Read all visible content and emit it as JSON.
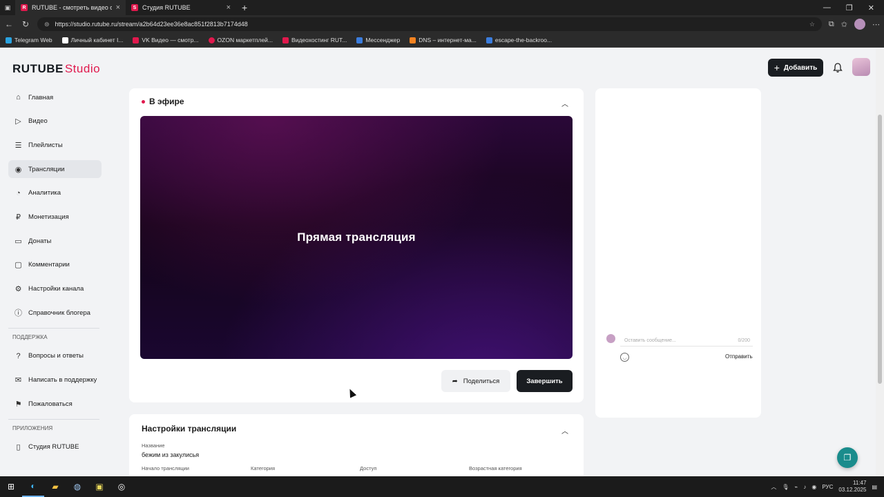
{
  "browser": {
    "tabs": [
      {
        "title": "RUTUBE - смотреть видео онла...",
        "icon": "R"
      },
      {
        "title": "Студия RUTUBE",
        "icon": "S"
      }
    ],
    "url": "https://studio.rutube.ru/stream/a2b64d23ee36e8ac851f2813b7174d48",
    "bookmarks": [
      {
        "label": "Telegram Web",
        "color": "#2aa3e0"
      },
      {
        "label": "Личный кабинет I...",
        "color": "#ffffff"
      },
      {
        "label": "VK Видео — смотр...",
        "color": "#e0194d"
      },
      {
        "label": "OZON маркетплей...",
        "color": "#e0194d"
      },
      {
        "label": "Видеохостинг RUT...",
        "color": "#e0194d"
      },
      {
        "label": "Мессенджер",
        "color": "#3b7ddd"
      },
      {
        "label": "DNS – интернет-ма...",
        "color": "#f58220"
      },
      {
        "label": "escape-the-backroo...",
        "color": "#3b7ddd"
      }
    ]
  },
  "header": {
    "logo_main": "RUTUBE",
    "logo_studio": "Studio",
    "add_button": "Добавить"
  },
  "sidebar": {
    "items": [
      {
        "label": "Главная",
        "icon": "home-icon"
      },
      {
        "label": "Видео",
        "icon": "video-icon"
      },
      {
        "label": "Плейлисты",
        "icon": "playlist-icon"
      },
      {
        "label": "Трансляции",
        "icon": "broadcast-icon"
      },
      {
        "label": "Аналитика",
        "icon": "analytics-icon"
      },
      {
        "label": "Монетизация",
        "icon": "ruble-icon"
      },
      {
        "label": "Донаты",
        "icon": "donate-icon"
      },
      {
        "label": "Комментарии",
        "icon": "comment-icon"
      },
      {
        "label": "Настройки канала",
        "icon": "gear-icon"
      },
      {
        "label": "Справочник блогера",
        "icon": "info-icon"
      }
    ],
    "support_heading": "ПОДДЕРЖКА",
    "support_items": [
      {
        "label": "Вопросы и ответы"
      },
      {
        "label": "Написать в поддержку"
      },
      {
        "label": "Пожаловаться"
      }
    ],
    "apps_heading": "ПРИЛОЖЕНИЯ",
    "apps_items": [
      {
        "label": "Студия RUTUBE"
      }
    ]
  },
  "live": {
    "title": "В эфире",
    "player_text": "Прямая трансляция",
    "share_button": "Поделиться",
    "finish_button": "Завершить"
  },
  "settings": {
    "title": "Настройки трансляции",
    "name_label": "Название",
    "name_value": "бежим из закулисья",
    "start_label": "Начало трансляции",
    "category_label": "Категория",
    "access_label": "Доступ",
    "age_label": "Возрастная категория"
  },
  "chat": {
    "placeholder": "Оставить сообщение...",
    "counter": "0/200",
    "send": "Отправить"
  },
  "taskbar": {
    "lang": "РУС",
    "time": "11:47",
    "date": "03.12.2025"
  }
}
